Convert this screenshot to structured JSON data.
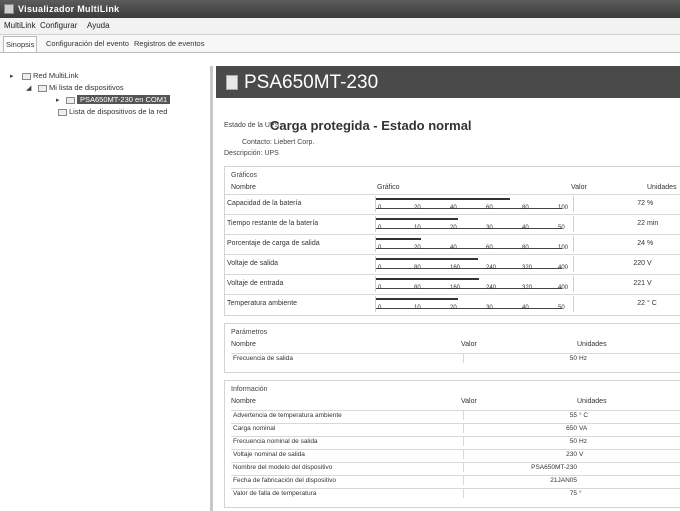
{
  "window": {
    "title": "Visualizador MultiLink"
  },
  "menu": [
    "MultiLink",
    "Configurar",
    "Ayuda"
  ],
  "tabs": [
    {
      "label": "Sinopsis",
      "active": true
    },
    {
      "label": "Configuración del evento",
      "active": false
    },
    {
      "label": "Registros de eventos",
      "active": false
    }
  ],
  "tree": {
    "root": "Red MultiLink",
    "group": "Mi lista de dispositivos",
    "device": "PSA650MT-230 en COM1",
    "network_list": "Lista de dispositivos de la red"
  },
  "device": {
    "title": "PSA650MT-230",
    "ups_state_label": "Estado de la UPS:",
    "status": "Carga protegida - Estado normal",
    "contact": "Contacto: Liebert Corp.",
    "description": "Descripción: UPS"
  },
  "graphics": {
    "section": "Gráficos",
    "col_name": "Nombre",
    "col_graph": "Gráfico",
    "col_value": "Valor",
    "col_units": "Unidades",
    "rows": [
      {
        "name": "Capacidad de la batería",
        "value": "72",
        "unit": "%",
        "ticks": [
          "0",
          "20",
          "40",
          "60",
          "80",
          "100"
        ],
        "fraction": 0.72
      },
      {
        "name": "Tiempo restante de la batería",
        "value": "22",
        "unit": "min",
        "ticks": [
          "0",
          "10",
          "20",
          "30",
          "40",
          "50"
        ],
        "fraction": 0.44
      },
      {
        "name": "Porcentaje de carga de salida",
        "value": "24",
        "unit": "%",
        "ticks": [
          "0",
          "20",
          "40",
          "60",
          "80",
          "100"
        ],
        "fraction": 0.24
      },
      {
        "name": "Voltaje de salida",
        "value": "220",
        "unit": "V",
        "ticks": [
          "0",
          "80",
          "160",
          "240",
          "320",
          "400"
        ],
        "fraction": 0.55
      },
      {
        "name": "Voltaje de entrada",
        "value": "221",
        "unit": "V",
        "ticks": [
          "0",
          "80",
          "160",
          "240",
          "320",
          "400"
        ],
        "fraction": 0.5525
      },
      {
        "name": "Temperatura ambiente",
        "value": "22",
        "unit": "° C",
        "ticks": [
          "0",
          "10",
          "20",
          "30",
          "40",
          "50"
        ],
        "fraction": 0.44
      }
    ]
  },
  "parameters": {
    "section": "Parámetros",
    "col_name": "Nombre",
    "col_value": "Valor",
    "col_units": "Unidades",
    "rows": [
      {
        "name": "Frecuencia de salida",
        "value": "50",
        "unit": "Hz"
      }
    ]
  },
  "information": {
    "section": "Información",
    "col_name": "Nombre",
    "col_value": "Valor",
    "col_units": "Unidades",
    "rows": [
      {
        "name": "Advertencia de temperatura ambiente",
        "value": "55",
        "unit": "° C"
      },
      {
        "name": "Carga nominal",
        "value": "650",
        "unit": "VA"
      },
      {
        "name": "Frecuencia nominal de salida",
        "value": "50",
        "unit": "Hz"
      },
      {
        "name": "Voltaje nominal de salida",
        "value": "230",
        "unit": "V"
      },
      {
        "name": "Nombre del modelo del dispositivo",
        "value": "PSA650MT-230",
        "unit": ""
      },
      {
        "name": "Fecha de fabricación del dispositivo",
        "value": "21JAN05",
        "unit": ""
      },
      {
        "name": "Valor de falla de temperatura",
        "value": "75",
        "unit": "°"
      }
    ]
  }
}
